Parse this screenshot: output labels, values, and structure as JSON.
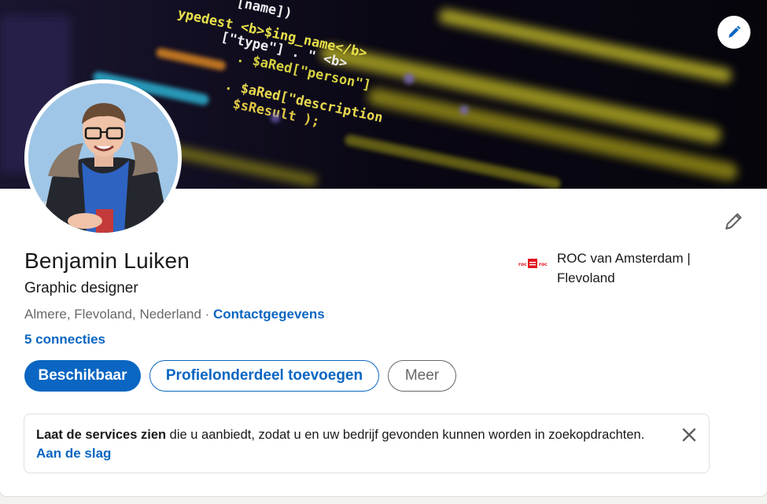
{
  "profile": {
    "name": "Benjamin Luiken",
    "headline": "Graphic designer",
    "location": "Almere, Flevoland, Nederland",
    "separator": " · ",
    "contact_link": "Contactgegevens",
    "connections": "5 connecties"
  },
  "company": {
    "name": "ROC van Amsterdam | Flevoland",
    "logo_text": "roc",
    "logo_color": "#e4151f"
  },
  "actions": {
    "primary": "Beschikbaar",
    "secondary": "Profielonderdeel toevoegen",
    "more": "Meer"
  },
  "notice": {
    "bold": "Laat de services zien",
    "text": " die u aanbiedt, zodat u en uw bedrijf gevonden kunnen worden in zoekopdrachten.",
    "link": "Aan de slag"
  },
  "banner": {
    "code_lines": [
      "[name])",
      "ypedest <b>$ing_name</b>",
      "[\"type\"] . \" <b>",
      ". $aRed[\"person\"]",
      "calculations? \" . $aRed[\"description\"]",
      "$sResult );"
    ]
  },
  "icons": {
    "banner_edit": "pencil-icon",
    "profile_edit": "pencil-icon",
    "close": "close-icon"
  },
  "colors": {
    "accent": "#0a66c2",
    "banner_code_yellow": "#e8e04a",
    "banner_bg": "#0a0714"
  }
}
